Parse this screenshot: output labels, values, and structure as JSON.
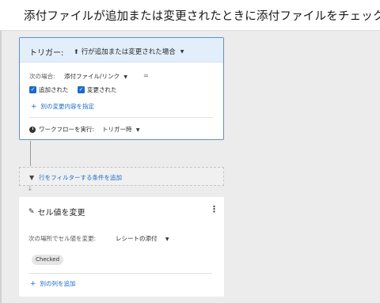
{
  "header": {
    "title": "添付ファイルが追加または変更されたときに添付ファイルをチェック"
  },
  "trigger": {
    "label": "トリガー:",
    "select_value": "行が追加または変更された場合",
    "condition_label": "次の場合:",
    "condition_field": "添付ファイル/リンク",
    "condition_operator": "=",
    "checkboxes": [
      {
        "label": "追加された",
        "checked": true
      },
      {
        "label": "変更された",
        "checked": true
      }
    ],
    "add_change_link": "別の変更内容を指定",
    "run_label": "ワークフローを実行:",
    "run_value": "トリガー時"
  },
  "filter": {
    "link": "行をフィルターする条件を追加"
  },
  "action": {
    "title": "セル値を変更",
    "dest_label": "次の場所でセル値を変更:",
    "dest_value": "レシートの添付",
    "chip": "Checked",
    "add_column_link": "別の列を追加"
  },
  "colors": {
    "accent": "#1b6ac9",
    "trigger_header_bg": "#e3eefb",
    "trigger_border": "#5a8fd6"
  },
  "icons": {
    "trigger": "person-upload-icon",
    "clock": "clock-icon",
    "filter": "funnel-icon",
    "edit": "pencil-icon",
    "menu": "kebab-menu-icon"
  }
}
